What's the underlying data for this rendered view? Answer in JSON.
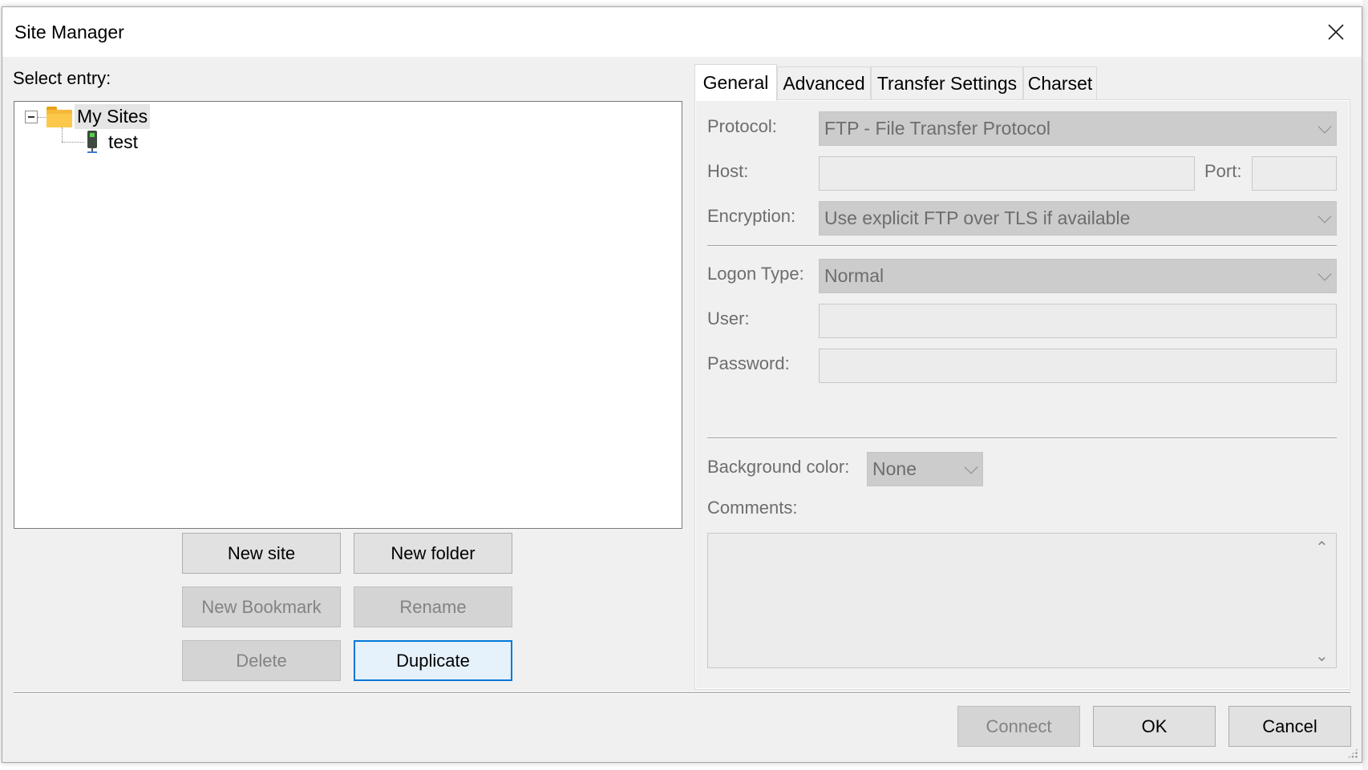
{
  "window": {
    "title": "Site Manager"
  },
  "left": {
    "select_label": "Select entry:",
    "tree": {
      "root": "My Sites",
      "child": "test"
    },
    "buttons": {
      "new_site": "New site",
      "new_folder": "New folder",
      "new_bookmark": "New Bookmark",
      "rename": "Rename",
      "delete": "Delete",
      "duplicate": "Duplicate"
    }
  },
  "tabs": [
    "General",
    "Advanced",
    "Transfer Settings",
    "Charset"
  ],
  "general": {
    "protocol_label": "Protocol:",
    "protocol_value": "FTP - File Transfer Protocol",
    "host_label": "Host:",
    "host_value": "",
    "port_label": "Port:",
    "port_value": "",
    "encryption_label": "Encryption:",
    "encryption_value": "Use explicit FTP over TLS if available",
    "logon_label": "Logon Type:",
    "logon_value": "Normal",
    "user_label": "User:",
    "user_value": "",
    "password_label": "Password:",
    "password_value": "",
    "bgcolor_label": "Background color:",
    "bgcolor_value": "None",
    "comments_label": "Comments:",
    "comments_value": ""
  },
  "footer": {
    "connect": "Connect",
    "ok": "OK",
    "cancel": "Cancel"
  },
  "icons": {
    "close": "close-icon",
    "folder": "folder-icon",
    "site": "server-icon",
    "collapse": "collapse-toggle-icon",
    "dropdown": "chevron-down-icon"
  },
  "colors": {
    "focus_border": "#0078d7",
    "folder": "#f7b93a"
  }
}
